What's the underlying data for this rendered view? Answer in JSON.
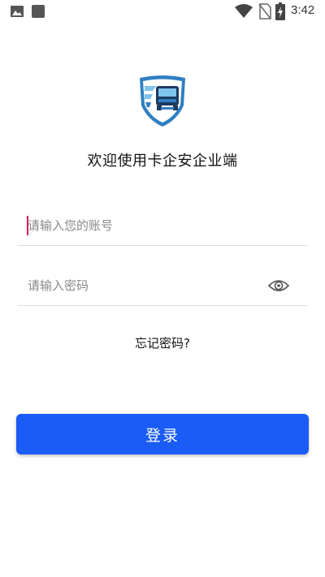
{
  "status_bar": {
    "time": "3:42",
    "icons": [
      "gallery-icon",
      "square-icon",
      "wifi-icon",
      "no-sim-icon",
      "battery-charging-icon"
    ]
  },
  "logo": {
    "icon": "truck-shield-logo",
    "colors": {
      "blue": "#2f7fc1",
      "light_blue": "#7fc4ec",
      "dark": "#1e3a5f"
    }
  },
  "welcome": {
    "title": "欢迎使用卡企安企业端"
  },
  "form": {
    "account_placeholder": "请输入您的账号",
    "password_placeholder": "请输入密码",
    "eye_icon": "eye-icon",
    "forgot_password": "忘记密码?",
    "login_label": "登录"
  },
  "colors": {
    "accent": "#1a5cf5",
    "caret": "#d81b60"
  }
}
